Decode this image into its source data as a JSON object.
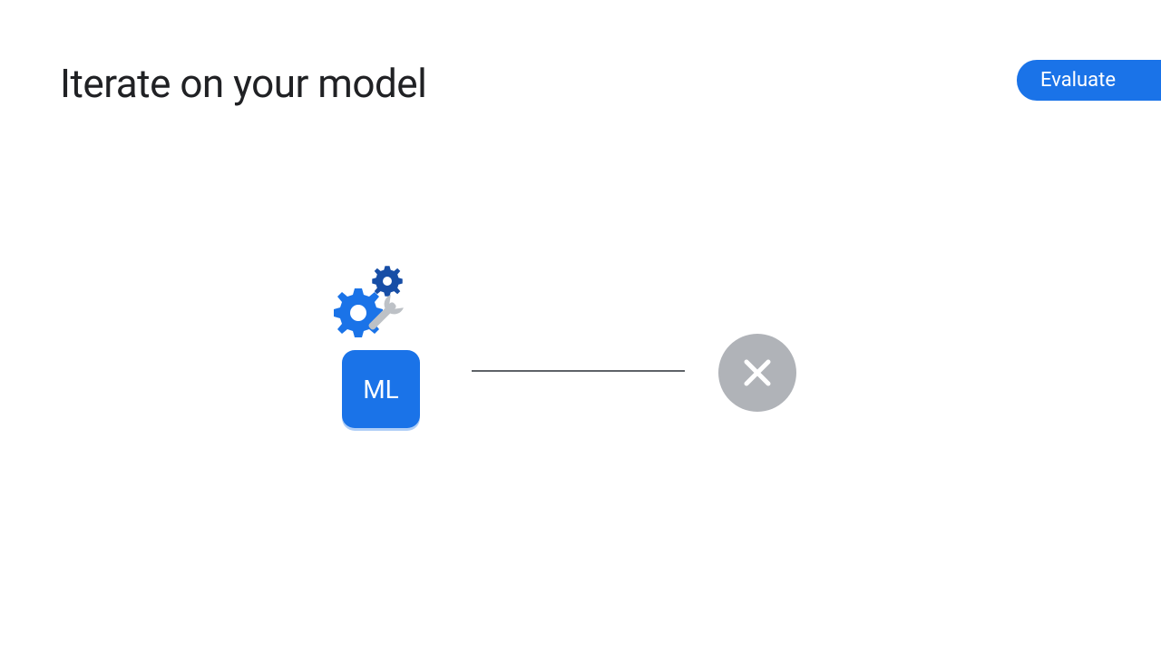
{
  "slide": {
    "title": "Iterate on your model"
  },
  "chip": {
    "label": "Evaluate"
  },
  "diagram": {
    "ml_label": "ML",
    "icons": {
      "gears": "gears-icon",
      "wrench": "wrench-icon",
      "close": "close-icon"
    }
  },
  "colors": {
    "primary_blue": "#1a73e8",
    "dark_blue": "#174ea6",
    "grey_circle": "#b0b3b8",
    "grey_wrench": "#bdc1c6",
    "text": "#202124",
    "line": "#5f6368"
  }
}
